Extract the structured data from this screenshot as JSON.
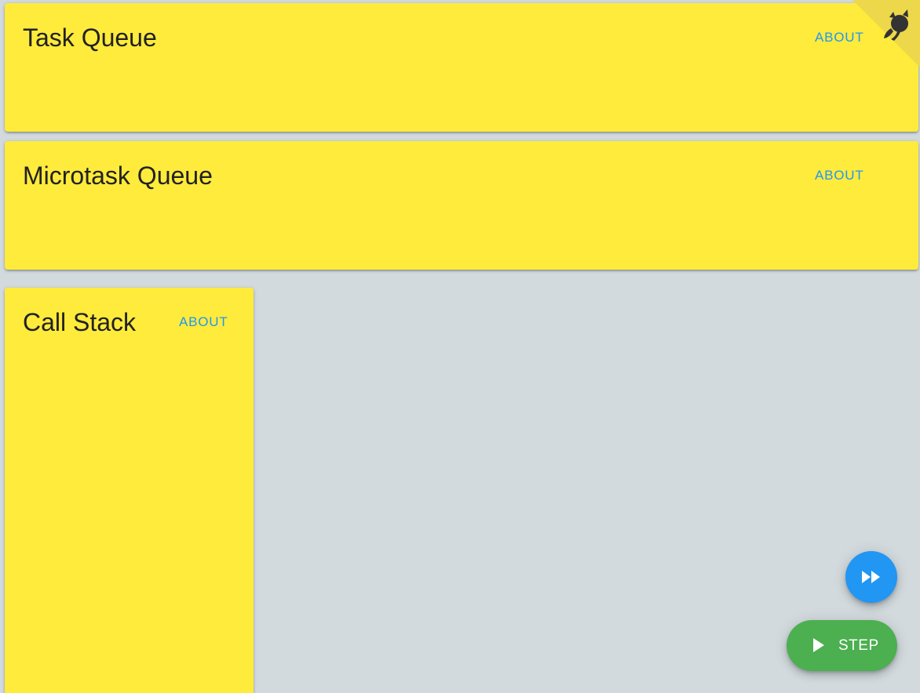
{
  "panels": {
    "task_queue": {
      "title": "Task Queue",
      "about_label": "ABOUT"
    },
    "microtask_queue": {
      "title": "Microtask Queue",
      "about_label": "ABOUT"
    },
    "call_stack": {
      "title": "Call Stack",
      "about_label": "ABOUT"
    }
  },
  "controls": {
    "fast_forward_icon": "fast-forward-icon",
    "step_label": "STEP",
    "step_icon": "play-icon"
  },
  "corner": {
    "icon": "github-octocat-icon"
  },
  "colors": {
    "background": "#d2dade",
    "panel": "#ffeb3b",
    "accent_blue": "#2196f3",
    "step_green": "#4caf50"
  }
}
